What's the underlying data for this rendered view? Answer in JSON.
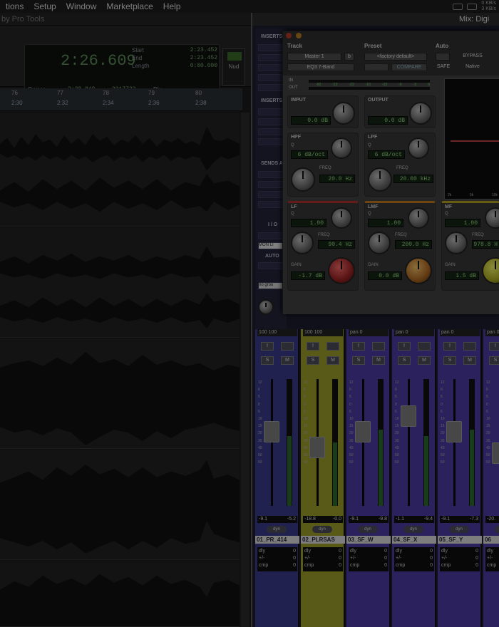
{
  "menubar": {
    "items": [
      "tions",
      "Setup",
      "Window",
      "Marketplace",
      "Help"
    ],
    "net_up": "0 KB/s",
    "net_down": "3 KB/s"
  },
  "edit_window": {
    "title": "by Pro Tools",
    "counter": {
      "main": "2:26.609",
      "start_label": "Start",
      "end_label": "End",
      "length_label": "Length",
      "start": "2:23.452",
      "end": "2:23.452",
      "length": "0:00.000",
      "cursor_label": "Cursor",
      "cursor_time": "2:38.849",
      "cursor_sample": "2317723",
      "dly_label": "Dly"
    },
    "nudge_label": "Nud",
    "ruler": {
      "bars": [
        "76",
        "77",
        "78",
        "79",
        "80"
      ],
      "times": [
        "2:30",
        "2:32",
        "2:34",
        "2:36",
        "2:38"
      ]
    }
  },
  "mix_window": {
    "title": "Mix: Digi",
    "sidebar": {
      "inserts": "INSERTS",
      "inserts2": "INSERTS",
      "sends": "SENDS A",
      "io": "I / O",
      "mon": "MON LI",
      "auto": "AUTO",
      "group": "no grou"
    },
    "channels": [
      {
        "pan_l": "100",
        "pan_r": "100",
        "vol_l": "-9.1",
        "vol_r": "-5.2",
        "name": "01_PR_414",
        "meter": 0.55,
        "fader": 0.6,
        "color": "#3a3a8a"
      },
      {
        "pan_l": "100",
        "pan_r": "100",
        "vol_l": "-18.8",
        "vol_r": "-0.0",
        "name": "02_PLRSAS",
        "meter": 0.5,
        "fader": 0.45,
        "color": "#9a9a2a"
      },
      {
        "pan_l": "pan",
        "pan_r": "0",
        "vol_l": "-9.1",
        "vol_r": "-9.8",
        "name": "03_SF_W",
        "meter": 0.6,
        "fader": 0.6,
        "color": "#4a3aa0"
      },
      {
        "pan_l": "pan",
        "pan_r": "0",
        "vol_l": "-1.1",
        "vol_r": "-9.4",
        "name": "04_SF_X",
        "meter": 0.55,
        "fader": 0.75,
        "color": "#4a3aa0"
      },
      {
        "pan_l": "pan",
        "pan_r": "0",
        "vol_l": "-9.1",
        "vol_r": "-7.3",
        "name": "05_SF_Y",
        "meter": 0.6,
        "fader": 0.6,
        "color": "#4a3aa0"
      },
      {
        "pan_l": "pan",
        "pan_r": "0",
        "vol_l": "-20.",
        "vol_r": "",
        "name": "06",
        "meter": 0.5,
        "fader": 0.4,
        "color": "#4a3aa0"
      }
    ],
    "strip_labels": {
      "solo": "S",
      "mute": "M",
      "rec": "I",
      "dyn": "dyn",
      "dly": "dly",
      "plusminus": "+/-",
      "cmp": "cmp",
      "zero": "0"
    },
    "fader_scale": [
      "12",
      "6",
      "5",
      "0",
      "5",
      "10",
      "15",
      "20",
      "30",
      "40",
      "50",
      "60"
    ]
  },
  "eq": {
    "track_label": "Track",
    "preset_label": "Preset",
    "auto_label": "Auto",
    "track": "Master 1",
    "track_b": "b",
    "preset": "<factory default>",
    "plugin": "EQ3 7-Band",
    "compare": "COMPARE",
    "safe": "SAFE",
    "bypass": "BYPASS",
    "native": "Native",
    "meter_in": "IN",
    "meter_out": "OUT",
    "meter_scale": [
      "-60",
      "-22",
      "-22",
      "-16",
      "-10",
      "-6",
      "-3",
      "0"
    ],
    "input": {
      "title": "INPUT",
      "value": "0.0 dB"
    },
    "output": {
      "title": "OUTPUT",
      "value": "0.0 dB"
    },
    "hpf": {
      "title": "HPF",
      "slope": "6 dB/oct",
      "freq_label": "FREQ",
      "freq": "20.0 Hz",
      "q": "Q"
    },
    "lpf": {
      "title": "LPF",
      "slope": "6 dB/oct",
      "freq_label": "FREQ",
      "freq": "20.00 kHz",
      "q": "Q"
    },
    "lf": {
      "title": "LF",
      "q_label": "Q",
      "q": "1.00",
      "freq_label": "FREQ",
      "freq": "90.4 Hz",
      "gain_label": "GAIN",
      "gain": "-1.7 dB"
    },
    "lmf": {
      "title": "LMF",
      "q_label": "Q",
      "q": "1.00",
      "freq_label": "FREQ",
      "freq": "200.0 Hz",
      "gain_label": "GAIN",
      "gain": "0.0 dB"
    },
    "mf": {
      "title": "MF",
      "q_label": "Q",
      "q": "1.00",
      "freq_label": "FREQ",
      "freq": "978.8 H",
      "gain_label": "GAIN",
      "gain": "1.5 dB"
    },
    "graph_x": [
      "2k",
      "5k",
      "10k"
    ]
  },
  "colors": {
    "lcd_green": "#8dd07a",
    "counter_green": "#5c8a56",
    "lf_accent": "#b03030",
    "lmf_accent": "#c07820",
    "mf_accent": "#b0a020"
  }
}
